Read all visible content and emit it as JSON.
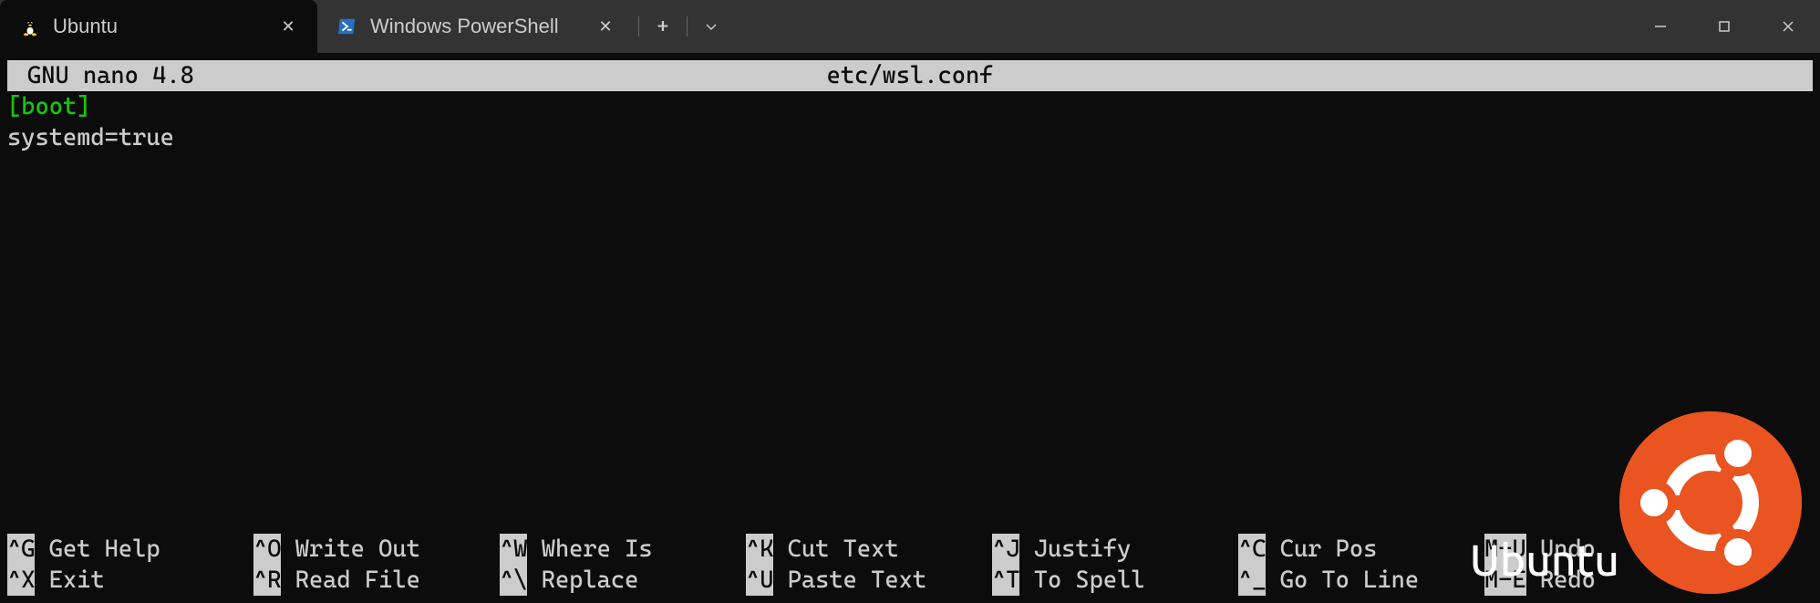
{
  "tabs": [
    {
      "title": "Ubuntu",
      "icon": "tux",
      "active": true
    },
    {
      "title": "Windows PowerShell",
      "icon": "powershell",
      "active": false
    }
  ],
  "nano": {
    "app_name": "GNU nano 4.8",
    "filename": "etc/wsl.conf",
    "content": {
      "section": "[boot]",
      "line1": "systemd=true"
    },
    "shortcuts_row1": [
      {
        "key": "^G",
        "label": " Get Help"
      },
      {
        "key": "^O",
        "label": " Write Out"
      },
      {
        "key": "^W",
        "label": " Where Is"
      },
      {
        "key": "^K",
        "label": " Cut Text"
      },
      {
        "key": "^J",
        "label": " Justify"
      },
      {
        "key": "^C",
        "label": " Cur Pos"
      },
      {
        "key": "M-U",
        "label": " Undo"
      }
    ],
    "shortcuts_row2": [
      {
        "key": "^X",
        "label": " Exit"
      },
      {
        "key": "^R",
        "label": " Read File"
      },
      {
        "key": "^\\",
        "label": " Replace"
      },
      {
        "key": "^U",
        "label": " Paste Text"
      },
      {
        "key": "^T",
        "label": " To Spell"
      },
      {
        "key": "^_",
        "label": " Go To Line"
      },
      {
        "key": "M-E",
        "label": " Redo"
      }
    ]
  },
  "watermark": {
    "text": "Ubuntu"
  }
}
